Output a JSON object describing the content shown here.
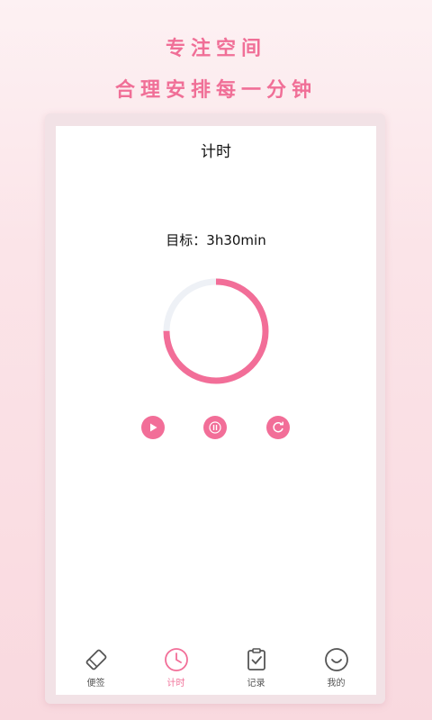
{
  "promo": {
    "line1": "专注空间",
    "line2": "合理安排每一分钟"
  },
  "screen": {
    "title": "计时",
    "goal_label": "目标：3h30min",
    "timer": {
      "progress": 0.75
    }
  },
  "controls": {
    "play": "play-icon",
    "pause": "pause-icon",
    "reset": "reset-icon"
  },
  "tabs": [
    {
      "label": "便签",
      "icon": "tag-icon"
    },
    {
      "label": "计时",
      "icon": "clock-icon",
      "active": true
    },
    {
      "label": "记录",
      "icon": "clipboard-check-icon"
    },
    {
      "label": "我的",
      "icon": "smile-icon"
    }
  ],
  "colors": {
    "accent": "#f26e98",
    "track": "#eef1f6",
    "inactive_icon": "#555555"
  }
}
